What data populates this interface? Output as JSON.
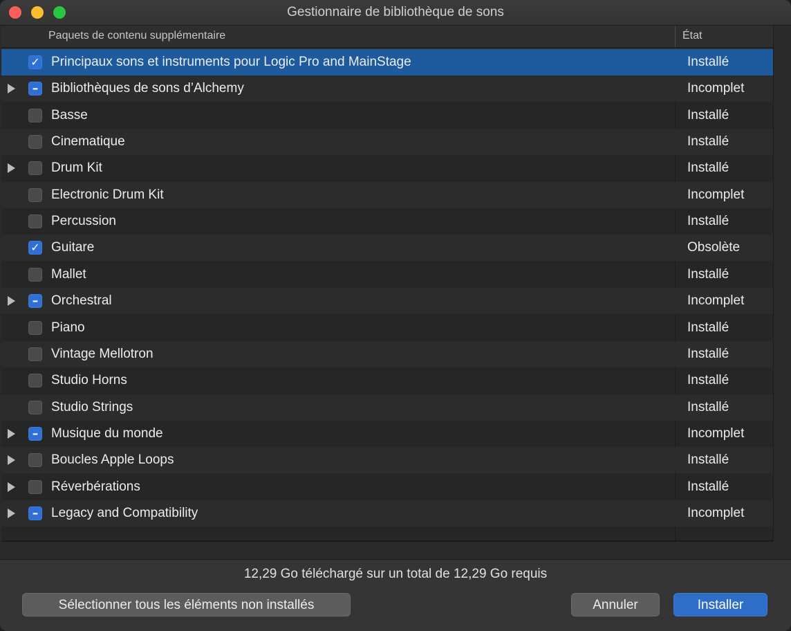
{
  "window": {
    "title": "Gestionnaire de bibliothèque de sons"
  },
  "table": {
    "col_name": "Paquets de contenu supplémentaire",
    "col_state": "État",
    "rows": [
      {
        "label": "Principaux sons et instruments pour Logic Pro and MainStage",
        "state": "Installé",
        "check": "checked",
        "expandable": false,
        "selected": true
      },
      {
        "label": "Bibliothèques de sons d’Alchemy",
        "state": "Incomplet",
        "check": "mixed",
        "expandable": true
      },
      {
        "label": "Basse",
        "state": "Installé",
        "check": "unchecked",
        "expandable": false
      },
      {
        "label": "Cinematique",
        "state": "Installé",
        "check": "unchecked",
        "expandable": false
      },
      {
        "label": "Drum Kit",
        "state": "Installé",
        "check": "unchecked",
        "expandable": true
      },
      {
        "label": "Electronic Drum Kit",
        "state": "Incomplet",
        "check": "unchecked",
        "expandable": false
      },
      {
        "label": "Percussion",
        "state": "Installé",
        "check": "unchecked",
        "expandable": false
      },
      {
        "label": "Guitare",
        "state": "Obsolète",
        "check": "checked",
        "expandable": false
      },
      {
        "label": "Mallet",
        "state": "Installé",
        "check": "unchecked",
        "expandable": false
      },
      {
        "label": "Orchestral",
        "state": "Incomplet",
        "check": "mixed",
        "expandable": true
      },
      {
        "label": "Piano",
        "state": "Installé",
        "check": "unchecked",
        "expandable": false
      },
      {
        "label": "Vintage Mellotron",
        "state": "Installé",
        "check": "unchecked",
        "expandable": false
      },
      {
        "label": "Studio Horns",
        "state": "Installé",
        "check": "unchecked",
        "expandable": false
      },
      {
        "label": "Studio Strings",
        "state": "Installé",
        "check": "unchecked",
        "expandable": false
      },
      {
        "label": "Musique du monde",
        "state": "Incomplet",
        "check": "mixed",
        "expandable": true
      },
      {
        "label": "Boucles Apple Loops",
        "state": "Installé",
        "check": "unchecked",
        "expandable": true
      },
      {
        "label": "Réverbérations",
        "state": "Installé",
        "check": "unchecked",
        "expandable": true
      },
      {
        "label": "Legacy and Compatibility",
        "state": "Incomplet",
        "check": "mixed",
        "expandable": true
      }
    ]
  },
  "footer": {
    "status": "12,29 Go téléchargé sur un total de 12,29 Go requis",
    "select_all_label": "Sélectionner tous les éléments non installés",
    "cancel_label": "Annuler",
    "install_label": "Installer"
  },
  "colors": {
    "selection": "#1d5a9e",
    "accent": "#2f6fd6",
    "install_button": "#2f6ec8"
  }
}
